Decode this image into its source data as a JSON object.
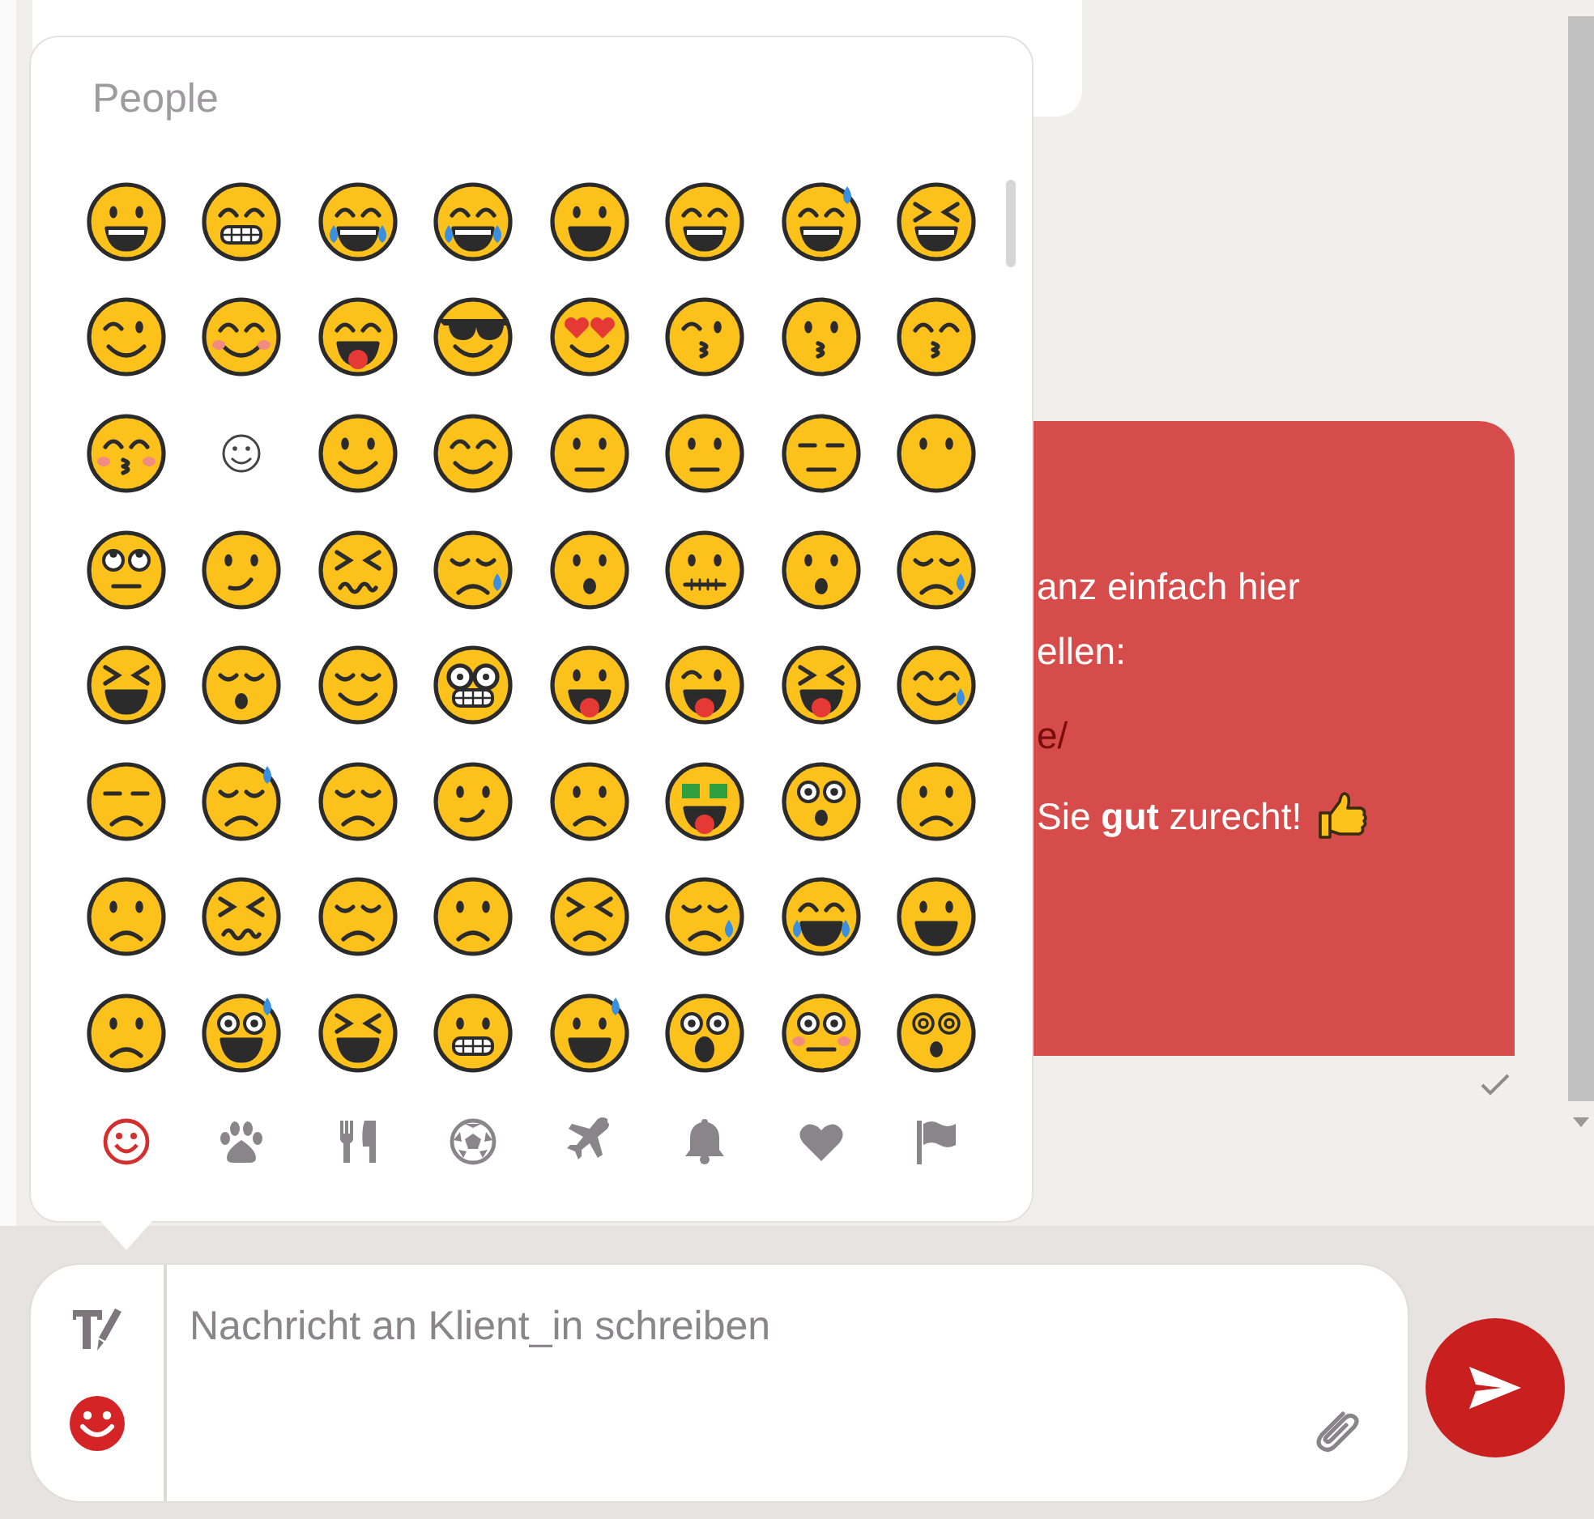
{
  "message": {
    "lines": [
      {
        "kind": "text",
        "text": "anz einfach hier"
      },
      {
        "kind": "text",
        "text": "ellen:"
      },
      {
        "kind": "link",
        "text": "e/"
      },
      {
        "kind": "text_thumb",
        "text": "Sie **gut** zurecht!"
      }
    ]
  },
  "emoji_picker": {
    "title": "People",
    "emojis": [
      {
        "kind": "grin"
      },
      {
        "kind": "beam"
      },
      {
        "kind": "laugh_tears"
      },
      {
        "kind": "laugh_tears"
      },
      {
        "kind": "smile_open"
      },
      {
        "kind": "grin_closed"
      },
      {
        "kind": "sweat_smile"
      },
      {
        "kind": "squint_laugh"
      },
      {
        "kind": "wink"
      },
      {
        "kind": "blush"
      },
      {
        "kind": "yum"
      },
      {
        "kind": "cool"
      },
      {
        "kind": "hearts"
      },
      {
        "kind": "kiss_heart"
      },
      {
        "kind": "kiss"
      },
      {
        "kind": "kiss_smile"
      },
      {
        "kind": "kiss_closed"
      },
      {
        "kind": "relaxed"
      },
      {
        "kind": "slight_smile"
      },
      {
        "kind": "hug"
      },
      {
        "kind": "thinking"
      },
      {
        "kind": "neutral"
      },
      {
        "kind": "expressionless"
      },
      {
        "kind": "no_mouth"
      },
      {
        "kind": "eyeroll"
      },
      {
        "kind": "smirk"
      },
      {
        "kind": "persevere"
      },
      {
        "kind": "sad_relieved"
      },
      {
        "kind": "hushed"
      },
      {
        "kind": "zipper"
      },
      {
        "kind": "hushed"
      },
      {
        "kind": "sleepy"
      },
      {
        "kind": "tired"
      },
      {
        "kind": "sleeping"
      },
      {
        "kind": "relieved"
      },
      {
        "kind": "nerd"
      },
      {
        "kind": "tongue"
      },
      {
        "kind": "tongue_wink"
      },
      {
        "kind": "tongue_squint"
      },
      {
        "kind": "drool"
      },
      {
        "kind": "unamused"
      },
      {
        "kind": "downcast_sweat"
      },
      {
        "kind": "pensive"
      },
      {
        "kind": "confused"
      },
      {
        "kind": "upside"
      },
      {
        "kind": "money"
      },
      {
        "kind": "astonished"
      },
      {
        "kind": "frown"
      },
      {
        "kind": "frown"
      },
      {
        "kind": "confounded"
      },
      {
        "kind": "disappointed"
      },
      {
        "kind": "worried"
      },
      {
        "kind": "triumph"
      },
      {
        "kind": "cry"
      },
      {
        "kind": "sob"
      },
      {
        "kind": "anguished"
      },
      {
        "kind": "frown"
      },
      {
        "kind": "fearful"
      },
      {
        "kind": "weary"
      },
      {
        "kind": "grimace"
      },
      {
        "kind": "cold_sweat"
      },
      {
        "kind": "scream"
      },
      {
        "kind": "flushed"
      },
      {
        "kind": "dizzy"
      }
    ],
    "categories": [
      {
        "kind": "smileys",
        "selected": true
      },
      {
        "kind": "animals",
        "selected": false
      },
      {
        "kind": "food",
        "selected": false
      },
      {
        "kind": "sports",
        "selected": false
      },
      {
        "kind": "travel",
        "selected": false
      },
      {
        "kind": "objects",
        "selected": false
      },
      {
        "kind": "symbols",
        "selected": false
      },
      {
        "kind": "flags",
        "selected": false
      }
    ]
  },
  "composer": {
    "placeholder": "Nachricht an Klient_in schreiben"
  }
}
